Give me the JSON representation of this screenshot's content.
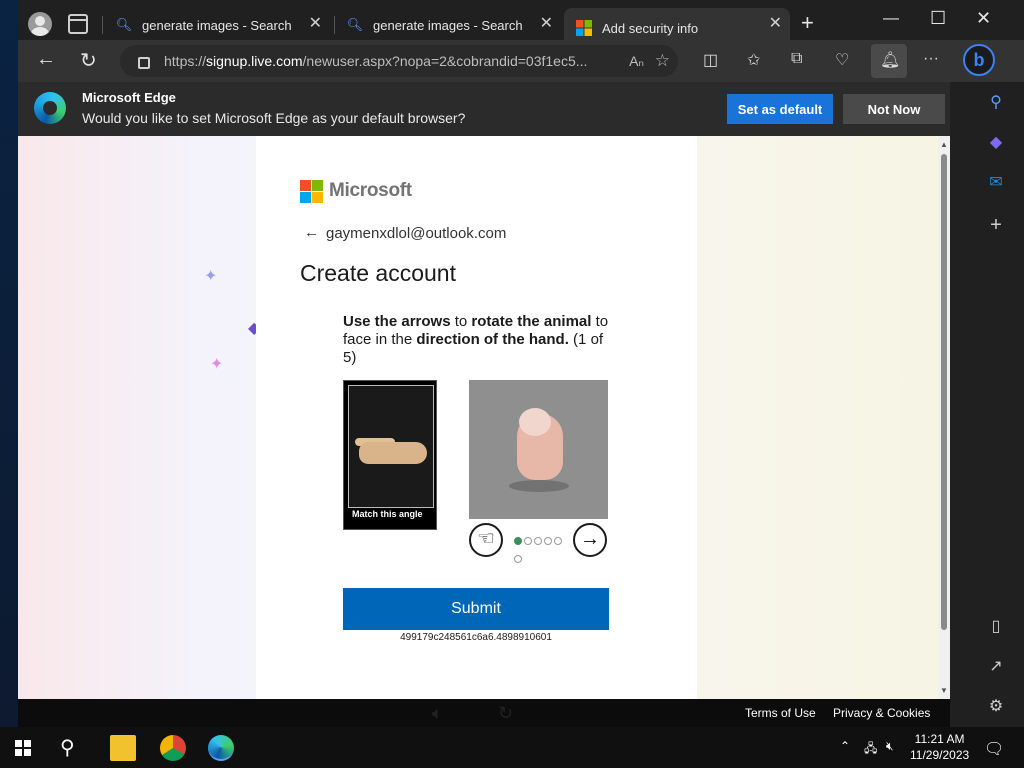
{
  "tabs": [
    {
      "label": "generate images - Search",
      "icon": "search-icon"
    },
    {
      "label": "generate images - Search",
      "icon": "search-icon"
    },
    {
      "label": "Add security info",
      "icon": "microsoft-icon"
    }
  ],
  "toolbar": {
    "url_prefix": "https://",
    "url_host": "signup.live.com",
    "url_rest": "/newuser.aspx?nopa=2&cobrandid=03f1ec5..."
  },
  "infobar": {
    "title": "Microsoft Edge",
    "message": "Would you like to set Microsoft Edge as your default browser?",
    "set_default_label": "Set as default",
    "not_now_label": "Not Now"
  },
  "page": {
    "brand": "Microsoft",
    "email": "gaymenxdlol@outlook.com",
    "heading": "Create account",
    "instruction_part1": "Use the arrows",
    "instruction_part2": " to ",
    "instruction_part3": "rotate the animal",
    "instruction_part4": " to face in the ",
    "instruction_part5": "direction of the hand.",
    "instruction_part6": " (1 of 5)",
    "hand_label": "Match this angle",
    "submit_label": "Submit",
    "session_id": "499179c248561c6a6.4898910601",
    "progress_current": 1,
    "progress_total": 5
  },
  "footer": {
    "terms": "Terms of Use",
    "privacy": "Privacy & Cookies"
  },
  "taskbar": {
    "time": "11:21 AM",
    "date": "11/29/2023"
  },
  "colors": {
    "submit_blue": "#0067b8",
    "set_default_blue": "#1a73d9",
    "progress_green": "#3c8f5a"
  }
}
